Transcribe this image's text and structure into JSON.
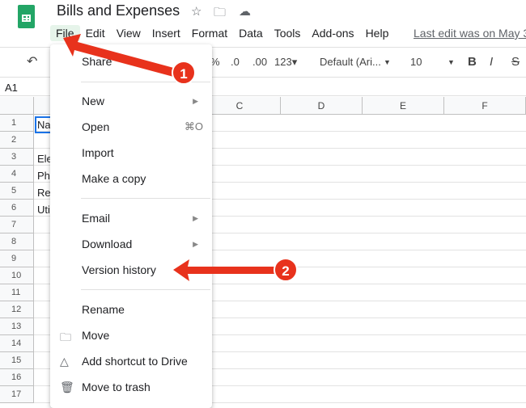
{
  "app": {
    "title": "Bills and Expenses",
    "last_edit": "Last edit was on May 3"
  },
  "menubar": [
    "File",
    "Edit",
    "View",
    "Insert",
    "Format",
    "Data",
    "Tools",
    "Add-ons",
    "Help"
  ],
  "toolbar": {
    "percent": "%",
    "dec_less": ".0",
    "dec_more": ".00",
    "format": "123▾",
    "font": "Default (Ari...",
    "font_size": "10",
    "bold": "B",
    "italic": "I"
  },
  "namebox": "A1",
  "columns": [
    "C",
    "D",
    "E",
    "F"
  ],
  "rows": [
    "1",
    "2",
    "3",
    "4",
    "5",
    "6",
    "7",
    "8",
    "9",
    "10",
    "11",
    "12",
    "13",
    "14",
    "15",
    "16",
    "17"
  ],
  "cells": {
    "r1": "Na",
    "r3": "Ele",
    "r4": "Ph",
    "r5": "Re",
    "r6": "Uti"
  },
  "file_menu": {
    "share": "Share",
    "new": "New",
    "open": "Open",
    "open_shortcut": "⌘O",
    "import": "Import",
    "copy": "Make a copy",
    "email": "Email",
    "download": "Download",
    "version": "Version history",
    "rename": "Rename",
    "move": "Move",
    "shortcut": "Add shortcut to Drive",
    "trash": "Move to trash"
  },
  "annotations": [
    "1",
    "2"
  ],
  "colors": {
    "arrow": "#e8321c",
    "sheets_green": "#23a566"
  }
}
